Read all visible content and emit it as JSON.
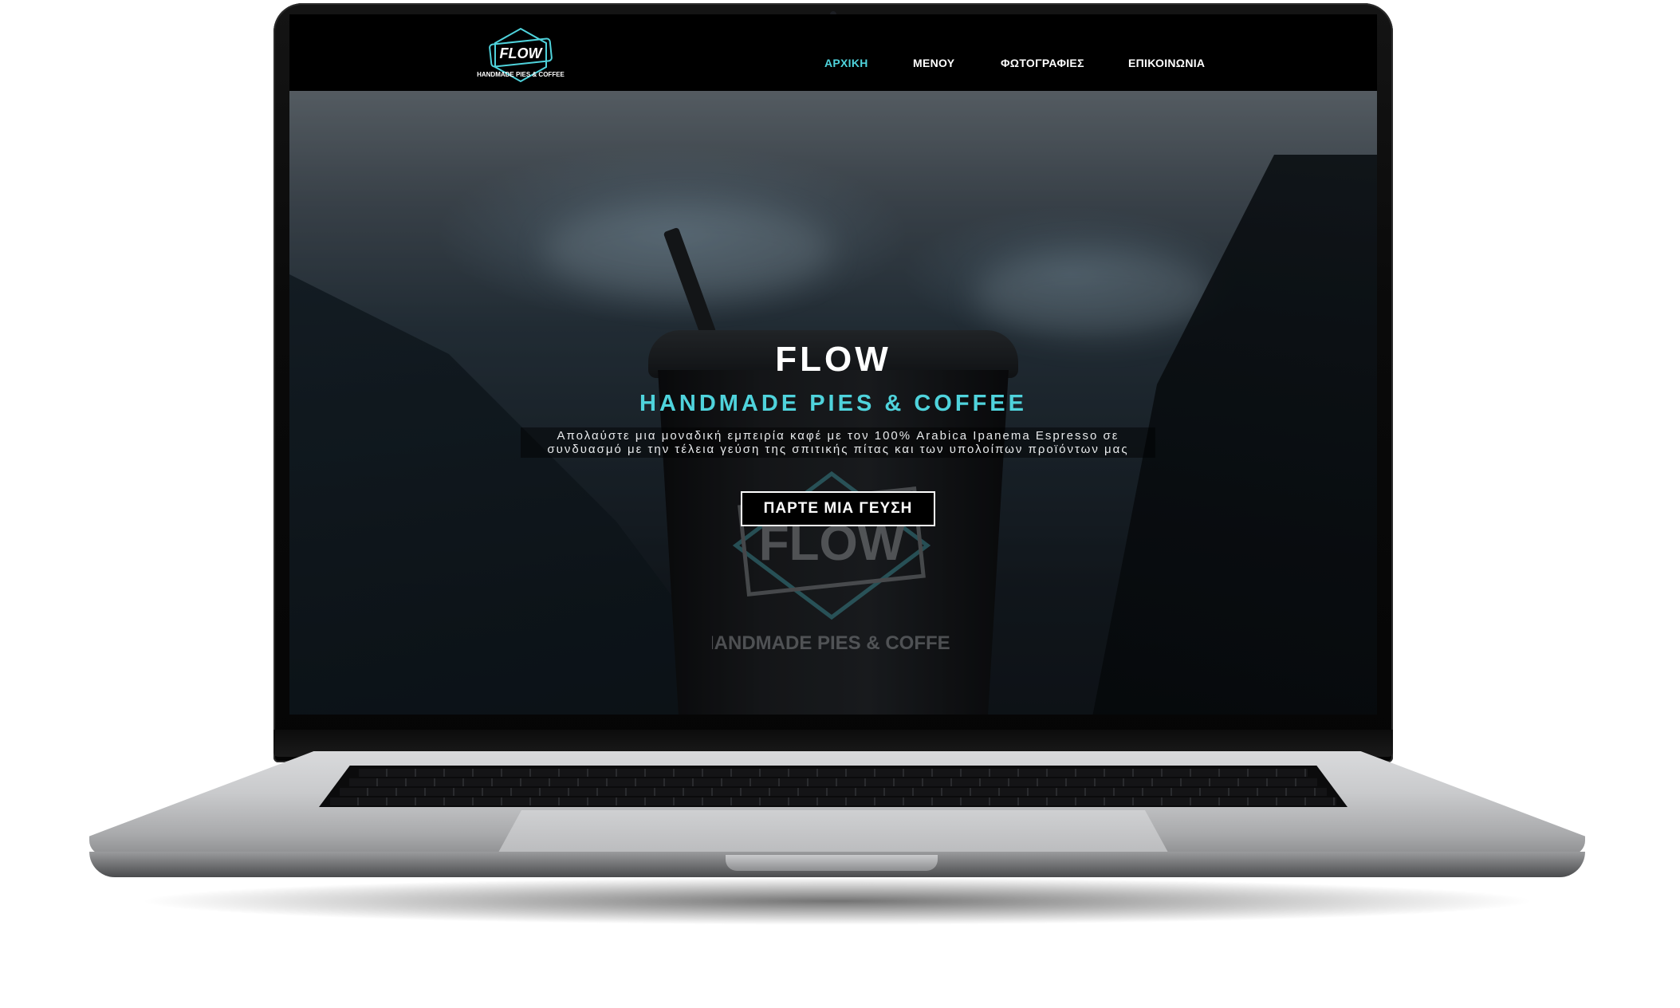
{
  "brand": {
    "logo_word": "FLOW",
    "logo_tagline": "HANDMADE PIES & COFFEE"
  },
  "nav": {
    "items": [
      {
        "label": "ΑΡΧΙΚΗ",
        "active": true
      },
      {
        "label": "ΜΕΝΟΥ",
        "active": false
      },
      {
        "label": "ΦΩΤΟΓΡΑΦΙΕΣ",
        "active": false
      },
      {
        "label": "ΕΠΙΚΟΙΝΩΝΙΑ",
        "active": false
      }
    ]
  },
  "hero": {
    "title": "FLOW",
    "subtitle": "HANDMADE PIES & COFFEE",
    "description": "Απολαύστε μια μοναδική εμπειρία καφέ με τον 100% Arabica Ipanema Espresso σε συνδυασμό με την τέλεια γεύση της σπιτικής πίτας και των υπολοίπων προϊόντων μας",
    "cta_label": "ΠΑΡΤΕ ΜΙΑ ΓΕΥΣΗ",
    "cup_print_word": "FLOW",
    "cup_print_tagline": "HANDMADE PIES & COFFEE"
  },
  "colors": {
    "accent": "#4fd3dc",
    "nav_bg": "#000000",
    "text": "#ffffff"
  }
}
